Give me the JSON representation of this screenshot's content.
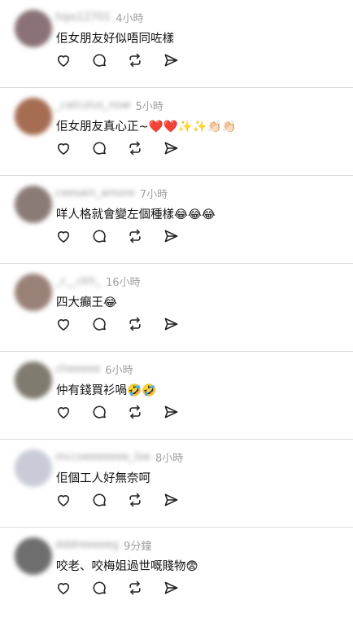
{
  "posts": [
    {
      "username": "hips12701",
      "time": "4小時",
      "text": "佢女朋友好似唔同咗樣",
      "avatar_color": "#8a7276"
    },
    {
      "username": "_calculus_now",
      "time": "5小時",
      "text": "佢女朋友真心正~❤️❤️✨✨👏🏻👏🏻",
      "avatar_color": "#a56d52"
    },
    {
      "username": "ceesain_amore",
      "time": "7小時",
      "text": "咩人格就會變左個種樣😂😂😂",
      "avatar_color": "#8b7b76"
    },
    {
      "username": "_c__ckh_",
      "time": "16小時",
      "text": "四大癲王😂",
      "avatar_color": "#9a8177"
    },
    {
      "username": "cheeeee",
      "time": "6小時",
      "text": "仲有錢買衫喎🤣🤣",
      "avatar_color": "#7f7b6f"
    },
    {
      "username": "mccoeeeeeee_loe",
      "time": "8小時",
      "text": "佢個工人好無奈呵",
      "avatar_color": "#c9ccd8"
    },
    {
      "username": "dddreeeeeg",
      "time": "9分鐘",
      "text": "咬老、咬梅姐過世嘅賤物😨",
      "avatar_color": "#6e6e6e"
    }
  ],
  "actions": {
    "like_icon": "heart-icon",
    "comment_icon": "comment-icon",
    "repost_icon": "repost-icon",
    "share_icon": "send-icon"
  }
}
